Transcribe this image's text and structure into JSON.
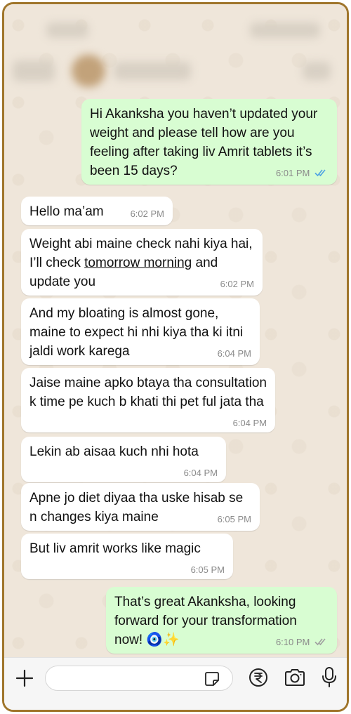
{
  "chat": {
    "messages": [
      {
        "direction": "out",
        "text": "Hi Akanksha you haven’t updated your weight and please tell how are you feeling after taking liv Amrit tablets it’s been 15 days?",
        "time": "6:01 PM",
        "status": "read"
      },
      {
        "direction": "in",
        "text": "Hello ma’am",
        "time": "6:02 PM"
      },
      {
        "direction": "in",
        "text_before": "Weight abi maine check nahi kiya hai, I’ll check ",
        "text_underlined": "tomorrow morning",
        "text_after": " and update you",
        "time": "6:02 PM"
      },
      {
        "direction": "in",
        "text": "And my bloating is almost gone, maine to expect hi nhi kiya tha ki itni jaldi work karega",
        "time": "6:04 PM"
      },
      {
        "direction": "in",
        "text": "Jaise maine apko btaya tha consultation k time pe kuch b khati thi pet ful jata tha",
        "time": "6:04 PM"
      },
      {
        "direction": "in",
        "text": "Lekin ab aisaa kuch nhi hota",
        "time": "6:04 PM"
      },
      {
        "direction": "in",
        "text": "Apne jo diet diyaa tha uske hisab se n changes kiya maine",
        "time": "6:05 PM"
      },
      {
        "direction": "in",
        "text": "But liv amrit works like magic",
        "time": "6:05 PM"
      },
      {
        "direction": "out",
        "text": "That’s great Akanksha, looking forward for your transformation now! 🧿✨",
        "time": "6:10 PM",
        "status": "delivered"
      }
    ]
  },
  "colors": {
    "outgoing_bubble": "#d8fdd2",
    "incoming_bubble": "#ffffff",
    "read_ticks": "#4fa3e3",
    "delivered_ticks": "#a0a0a0",
    "frame_border": "#a0762c"
  },
  "input_bar": {
    "icons": [
      "plus-icon",
      "sticker-icon",
      "rupee-payment-icon",
      "camera-icon",
      "microphone-icon"
    ]
  }
}
